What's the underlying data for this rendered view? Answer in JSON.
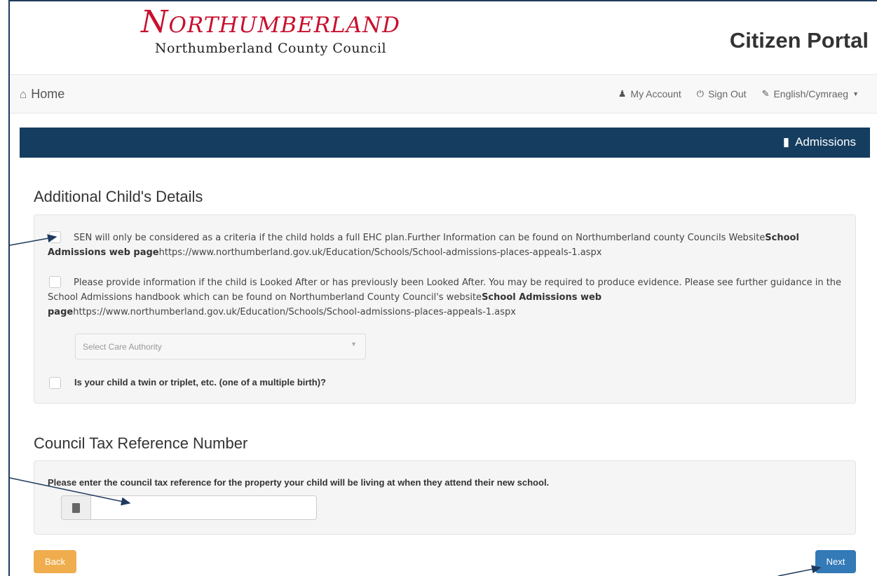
{
  "header": {
    "logo_text": "Northumberland",
    "council_name": "Northumberland County Council",
    "portal_title": "Citizen Portal"
  },
  "nav": {
    "home": "Home",
    "my_account": "My Account",
    "sign_out": "Sign Out",
    "language": "English/Cymraeg"
  },
  "section_bar": {
    "label": "Admissions"
  },
  "additional_details": {
    "heading": "Additional Child's Details",
    "sen": {
      "text_1": "SEN will only be considered as a criteria if the child holds a full EHC plan.Further Information can be found on Northumberland county Councils Website",
      "link_label": "School Admissions web page",
      "url": "https://www.northumberland.gov.uk/Education/Schools/School-admissions-places-appeals-1.aspx"
    },
    "looked_after": {
      "text_1": "Please provide information if the child is Looked After or has previously been Looked After. You may be required to produce evidence. Please see further guidance in the School Admissions handbook which can be found on Northumberland County Council's website",
      "link_label": "School Admissions web page",
      "url": "https://www.northumberland.gov.uk/Education/Schools/School-admissions-places-appeals-1.aspx"
    },
    "care_authority_placeholder": "Select Care Authority",
    "twin_label": "Is your child a twin or triplet, etc. (one of a multiple birth)?"
  },
  "council_tax": {
    "heading": "Council Tax Reference Number",
    "label": "Please enter the council tax reference for the property your child will be living at when they attend their new school.",
    "value": ""
  },
  "buttons": {
    "back": "Back",
    "next": "Next"
  },
  "colors": {
    "bar": "#143d60",
    "back": "#f0ad4e",
    "next": "#337ab7",
    "logo": "#c8102e"
  }
}
